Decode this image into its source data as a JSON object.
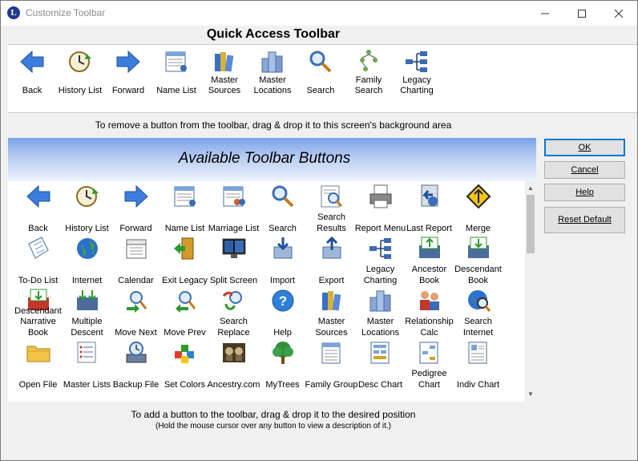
{
  "window": {
    "title": "Customize Toolbar",
    "app_icon_letter": "L",
    "minimize": "—",
    "maximize": "☐",
    "close": "✕"
  },
  "quick_access": {
    "heading": "Quick Access Toolbar",
    "buttons": [
      {
        "label": "Back",
        "icon": "back-arrow-icon"
      },
      {
        "label": "History List",
        "icon": "history-clock-icon"
      },
      {
        "label": "Forward",
        "icon": "forward-arrow-icon"
      },
      {
        "label": "Name List",
        "icon": "name-list-icon"
      },
      {
        "label": "Master Sources",
        "icon": "books-icon"
      },
      {
        "label": "Master Locations",
        "icon": "buildings-icon"
      },
      {
        "label": "Search",
        "icon": "magnifier-icon"
      },
      {
        "label": "Family Search",
        "icon": "tree-chart-icon"
      },
      {
        "label": "Legacy Charting",
        "icon": "charting-icon"
      }
    ]
  },
  "remove_hint": "To remove a button from the toolbar, drag & drop it to this screen's background area",
  "available": {
    "title": "Available Toolbar Buttons",
    "buttons": [
      {
        "label": "Back",
        "icon": "back-arrow-icon"
      },
      {
        "label": "History List",
        "icon": "history-clock-icon"
      },
      {
        "label": "Forward",
        "icon": "forward-arrow-icon"
      },
      {
        "label": "Name List",
        "icon": "name-list-icon"
      },
      {
        "label": "Marriage List",
        "icon": "marriage-list-icon"
      },
      {
        "label": "Search",
        "icon": "magnifier-icon"
      },
      {
        "label": "Search Results",
        "icon": "search-results-icon"
      },
      {
        "label": "Report Menu",
        "icon": "printer-icon"
      },
      {
        "label": "Last Report",
        "icon": "last-report-icon"
      },
      {
        "label": "Merge",
        "icon": "merge-sign-icon"
      },
      {
        "label": "To-Do List",
        "icon": "todo-notepad-icon"
      },
      {
        "label": "Internet",
        "icon": "globe-icon"
      },
      {
        "label": "Calendar",
        "icon": "calendar-icon"
      },
      {
        "label": "Exit Legacy",
        "icon": "exit-door-icon"
      },
      {
        "label": "Split Screen",
        "icon": "split-screen-icon"
      },
      {
        "label": "Import",
        "icon": "import-icon"
      },
      {
        "label": "Export",
        "icon": "export-icon"
      },
      {
        "label": "Legacy Charting",
        "icon": "charting-icon"
      },
      {
        "label": "Ancestor Book",
        "icon": "ancestor-book-icon"
      },
      {
        "label": "Descendant Book",
        "icon": "descendant-book-icon"
      },
      {
        "label": "Descendant Narrative Book",
        "icon": "narrative-book-icon"
      },
      {
        "label": "Multiple Descent",
        "icon": "multiple-descent-icon"
      },
      {
        "label": "Move Next",
        "icon": "move-next-icon"
      },
      {
        "label": "Move Prev",
        "icon": "move-prev-icon"
      },
      {
        "label": "Search Replace",
        "icon": "search-replace-icon"
      },
      {
        "label": "Help",
        "icon": "help-icon"
      },
      {
        "label": "Master Sources",
        "icon": "books-icon"
      },
      {
        "label": "Master Locations",
        "icon": "buildings-icon"
      },
      {
        "label": "Relationship Calc",
        "icon": "relationship-icon"
      },
      {
        "label": "Search Internet",
        "icon": "search-internet-icon"
      },
      {
        "label": "Open File",
        "icon": "folder-icon"
      },
      {
        "label": "Master Lists",
        "icon": "master-lists-icon"
      },
      {
        "label": "Backup File",
        "icon": "backup-icon"
      },
      {
        "label": "Set Colors",
        "icon": "colors-icon"
      },
      {
        "label": "Ancestry.com",
        "icon": "ancestry-icon"
      },
      {
        "label": "MyTrees",
        "icon": "mytrees-icon"
      },
      {
        "label": "Family Group",
        "icon": "family-group-icon"
      },
      {
        "label": "Desc Chart",
        "icon": "desc-chart-icon"
      },
      {
        "label": "Pedigree Chart",
        "icon": "pedigree-chart-icon"
      },
      {
        "label": "Indiv Chart",
        "icon": "indiv-chart-icon"
      },
      {
        "label": "",
        "icon": "partial-icon"
      },
      {
        "label": "",
        "icon": "partial-icon"
      },
      {
        "label": "",
        "icon": "partial-icon"
      },
      {
        "label": "",
        "icon": "partial-icon"
      },
      {
        "label": "",
        "icon": "partial-icon"
      },
      {
        "label": "",
        "icon": "partial-icon"
      },
      {
        "label": "",
        "icon": "partial-icon"
      },
      {
        "label": "",
        "icon": "partial-icon"
      },
      {
        "label": "",
        "icon": "partial-icon"
      },
      {
        "label": "",
        "icon": "partial-icon"
      }
    ]
  },
  "add_hint": "To add a button to the toolbar, drag & drop it to the desired position",
  "add_hint_sub": "(Hold the mouse cursor over any button to view a description of it.)",
  "dialog_buttons": {
    "ok": "OK",
    "cancel": "Cancel",
    "help": "Help",
    "reset": "Reset Default"
  },
  "scrollbar": {
    "up": "▲",
    "down": "▼"
  }
}
